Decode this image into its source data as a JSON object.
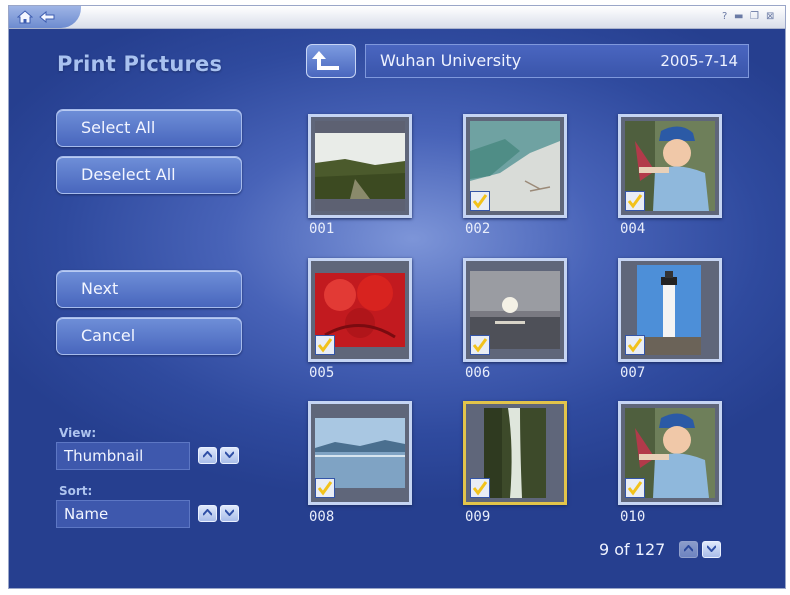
{
  "page_title": "Print Pictures",
  "location": {
    "name": "Wuhan University",
    "date": "2005-7-14"
  },
  "buttons": {
    "select_all": "Select All",
    "deselect_all": "Deselect All",
    "next": "Next",
    "cancel": "Cancel"
  },
  "view": {
    "label": "View:",
    "value": "Thumbnail"
  },
  "sort": {
    "label": "Sort:",
    "value": "Name"
  },
  "thumbnails": [
    {
      "caption": "001",
      "checked": false,
      "selected": false,
      "subject": "field landscape"
    },
    {
      "caption": "002",
      "checked": true,
      "selected": false,
      "subject": "beach"
    },
    {
      "caption": "004",
      "checked": true,
      "selected": false,
      "subject": "child with cap"
    },
    {
      "caption": "005",
      "checked": true,
      "selected": false,
      "subject": "red flowers"
    },
    {
      "caption": "006",
      "checked": true,
      "selected": false,
      "subject": "sunset over water"
    },
    {
      "caption": "007",
      "checked": true,
      "selected": false,
      "subject": "lighthouse"
    },
    {
      "caption": "008",
      "checked": true,
      "selected": false,
      "subject": "lake reflection"
    },
    {
      "caption": "009",
      "checked": true,
      "selected": true,
      "subject": "waterfall in forest"
    },
    {
      "caption": "010",
      "checked": true,
      "selected": false,
      "subject": "child with cap"
    }
  ],
  "pager": {
    "text": "9 of 127"
  },
  "colors": {
    "accent": "#4866bd",
    "selection": "#e2c44a",
    "checkmark": "#f2c21b"
  }
}
